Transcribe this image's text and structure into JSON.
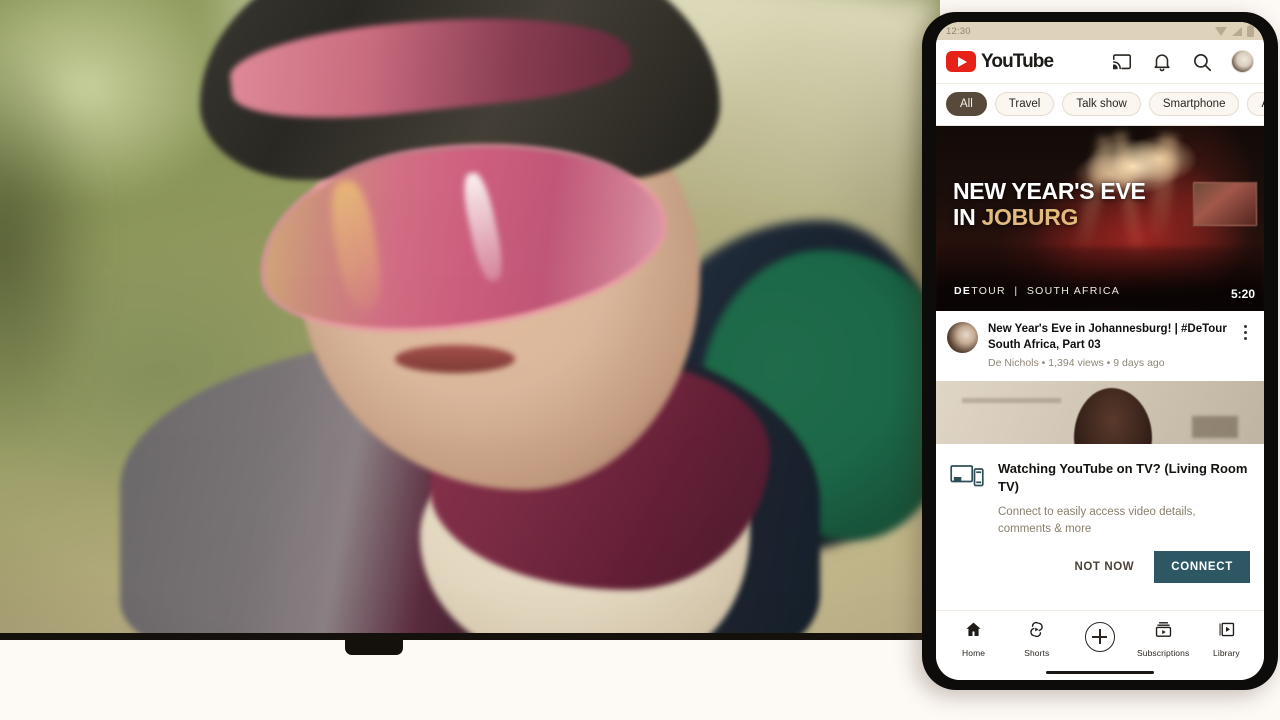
{
  "scene": {
    "tv_content_description": "Blurred point-of-view video of a cyclist wearing a helmet and pink mirrored sunglasses on a forest trail"
  },
  "phone": {
    "statusbar": {
      "time": "12:30",
      "icons": [
        "wifi-icon",
        "signal-icon",
        "battery-icon"
      ]
    },
    "header": {
      "logo_text": "YouTube",
      "icons": [
        {
          "name": "cast-icon"
        },
        {
          "name": "notifications-bell-icon"
        },
        {
          "name": "search-icon"
        },
        {
          "name": "account-avatar"
        }
      ]
    },
    "chips": [
      {
        "label": "All",
        "active": true
      },
      {
        "label": "Travel",
        "active": false
      },
      {
        "label": "Talk show",
        "active": false
      },
      {
        "label": "Smartphone",
        "active": false
      },
      {
        "label": "An",
        "active": false
      }
    ],
    "feed": {
      "video1": {
        "thumbnail": {
          "line1": "NEW YEAR'S EVE",
          "line2_prefix": "IN ",
          "line2_highlight": "JOBURG",
          "brand_bold": "DE",
          "brand_rest": "TOUR",
          "brand_divider": "|",
          "brand_region": "SOUTH AFRICA",
          "duration": "5:20"
        },
        "title": "New Year's Eve in Johannesburg! | #DeTour South Africa, Part 03",
        "meta": "De Nichols • 1,394 views • 9 days ago",
        "menu_icon": "kebab-menu-icon"
      },
      "video2": {
        "thumbnail_description": "Partially visible thumbnail of a person in a room"
      }
    },
    "dialog": {
      "icon": "tv-and-phone-icon",
      "title": "Watching YouTube on TV? (Living Room TV)",
      "description": "Connect to easily access video details, comments & more",
      "not_now_label": "NOT NOW",
      "connect_label": "CONNECT",
      "connect_color": "#2e5764"
    },
    "bottom_nav": [
      {
        "label": "Home",
        "icon": "home-icon"
      },
      {
        "label": "Shorts",
        "icon": "shorts-icon"
      },
      {
        "label": "",
        "icon": "create-plus-icon"
      },
      {
        "label": "Subscriptions",
        "icon": "subscriptions-icon"
      },
      {
        "label": "Library",
        "icon": "library-icon"
      }
    ]
  },
  "colors": {
    "youtube_red": "#e62117",
    "chip_active_bg": "#574a3b",
    "connect_teal": "#2e5764",
    "page_bg": "#fdf9f5",
    "statusbar_bg": "#ded2bb"
  }
}
